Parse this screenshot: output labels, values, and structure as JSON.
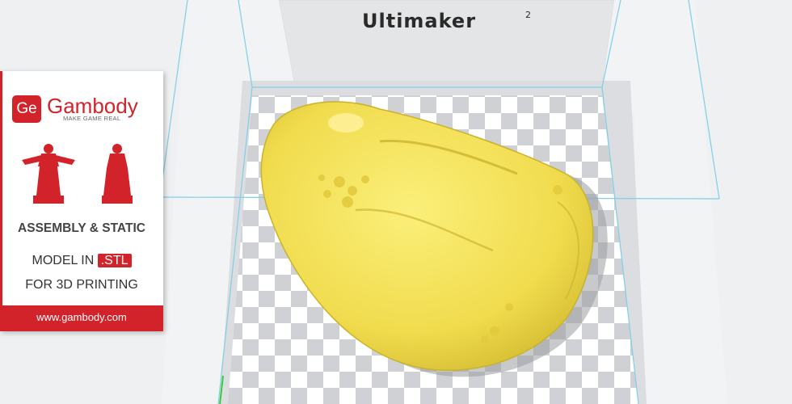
{
  "printer": {
    "brand": "Ultimaker",
    "model_sup": "2"
  },
  "colors": {
    "model": "#f4e35a",
    "model_shade": "#d8c23a",
    "bed_light": "#ffffff",
    "bed_dark": "#cfd1d4",
    "frame": "#7ecfe6",
    "accent": "#d2232a"
  },
  "promo": {
    "logo_letters": "Ge",
    "logo_name": "Gambody",
    "tagline": "MAKE GAME REAL",
    "line1": "ASSEMBLY & STATIC",
    "line2_prefix": "MODEL IN",
    "line2_badge": ".STL",
    "line3": "FOR 3D PRINTING",
    "url": "www.gambody.com"
  }
}
